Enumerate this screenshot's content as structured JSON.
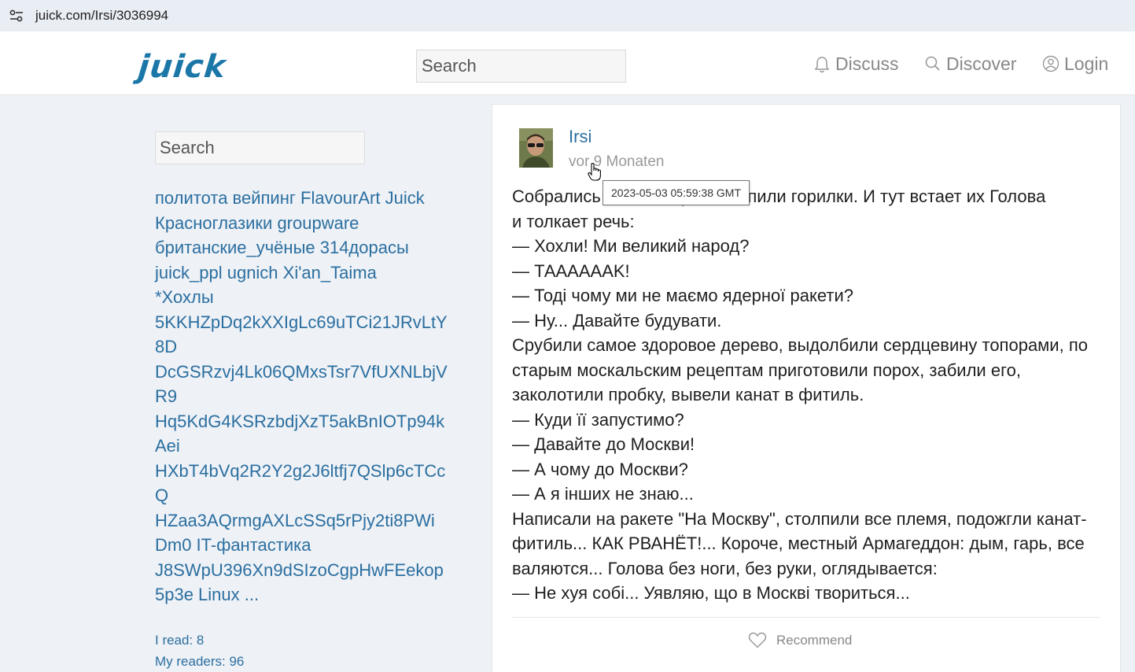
{
  "browser": {
    "url": "juick.com/Irsi/3036994"
  },
  "header": {
    "logo": "juick",
    "search_placeholder": "Search",
    "nav": {
      "discuss": "Discuss",
      "discover": "Discover",
      "login": "Login"
    }
  },
  "sidebar": {
    "search_placeholder": "Search",
    "tag_lines": [
      "политота вейпинг FlavourArt Juick",
      "Красноглазики groupware",
      "британские_учёные 314дорасы",
      "juick_ppl ugnich Xi'an_Taima",
      "*Хохлы",
      "5KKHZpDq2kXXIgLc69uTCi21JRvLtY",
      "8D",
      "DcGSRzvj4Lk06QMxsTsr7VfUXNLbjV",
      "R9",
      "Hq5KdG4KSRzbdjXzT5akBnIOTp94k",
      "Aei",
      "HXbT4bVq2R2Y2g2J6ltfj7QSlp6cTCc",
      "Q",
      "HZaa3AQrmgAXLcSSq5rPjy2ti8PWi",
      "Dm0 IT-фантастика",
      "J8SWpU396Xn9dSIzoCgpHwFEekop",
      "5p3e Linux ..."
    ],
    "stats": {
      "i_read": "I read: 8",
      "my_readers": "My readers: 96"
    }
  },
  "post": {
    "author": "Irsi",
    "time_relative": "vor 9 Monaten",
    "time_tooltip": "2023-05-03 05:59:38 GMT",
    "lines": [
      "Собрались хохлы в кучке, выпили горилки. И тут встает их Голова",
      "и толкает речь:",
      "— Хохли! Ми великий народ?",
      "— ТАААААAK!",
      "— Тоді чому ми не маємо ядерної ракети?",
      "— Ну... Давайте будувати.",
      "Срубили самое здоровое дерево, выдолбили сердцевину топорами, по",
      "старым москальским рецептам приготовили порох, забили его,",
      "заколотили пробку, вывели канат в фитиль.",
      "— Куди її запустимо?",
      "— Давайте до Москви!",
      "— А чому до Москви?",
      "— А я інших не знаю...",
      "Написали на ракете \"На Москву\", столпили все племя, подожгли канат-",
      "фитиль... КАК РВАНЁТ!... Короче, местный Армагеддон: дым, гарь, все",
      "валяются... Голова без ноги, без руки, оглядывается:",
      "— Не хуя собі... Уявляю, що в Москві твориться..."
    ],
    "recommend_label": "Recommend"
  },
  "colors": {
    "brand": "#1b77a8",
    "link": "#2b6fa0",
    "muted": "#888888"
  }
}
